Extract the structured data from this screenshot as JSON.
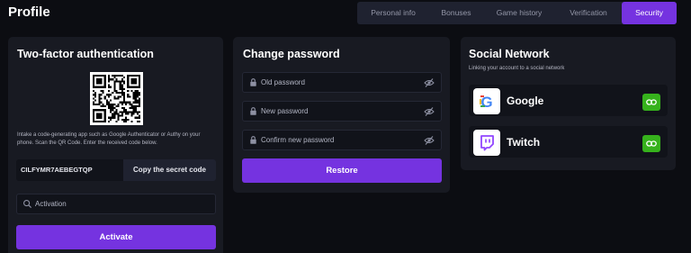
{
  "header": {
    "title": "Profile"
  },
  "tabs": [
    {
      "label": "Personal info",
      "active": false
    },
    {
      "label": "Bonuses",
      "active": false
    },
    {
      "label": "Game history",
      "active": false
    },
    {
      "label": "Verification",
      "active": false
    },
    {
      "label": "Security",
      "active": true
    }
  ],
  "two_factor": {
    "title": "Two-factor authentication",
    "description": "Intake a code-generating app such as Google Authenticator or Authy on your phone. Scan the QR Code. Enter the received code below.",
    "secret_code": "CILFYMR7AEBEGTQP",
    "copy_label": "Copy the secret code",
    "activation_placeholder": "Activation",
    "activate_label": "Activate"
  },
  "change_password": {
    "title": "Change password",
    "old_placeholder": "Old password",
    "new_placeholder": "New password",
    "confirm_placeholder": "Confirm new password",
    "restore_label": "Restore"
  },
  "social": {
    "title": "Social Network",
    "subtitle": "Linking your account to a social network",
    "networks": [
      {
        "name": "Google",
        "icon": "google-logo-icon"
      },
      {
        "name": "Twitch",
        "icon": "twitch-logo-icon"
      }
    ]
  },
  "colors": {
    "accent": "#7533e0",
    "link_green": "#36b21c",
    "card_bg": "#181a22",
    "page_bg": "#0c0d12"
  }
}
